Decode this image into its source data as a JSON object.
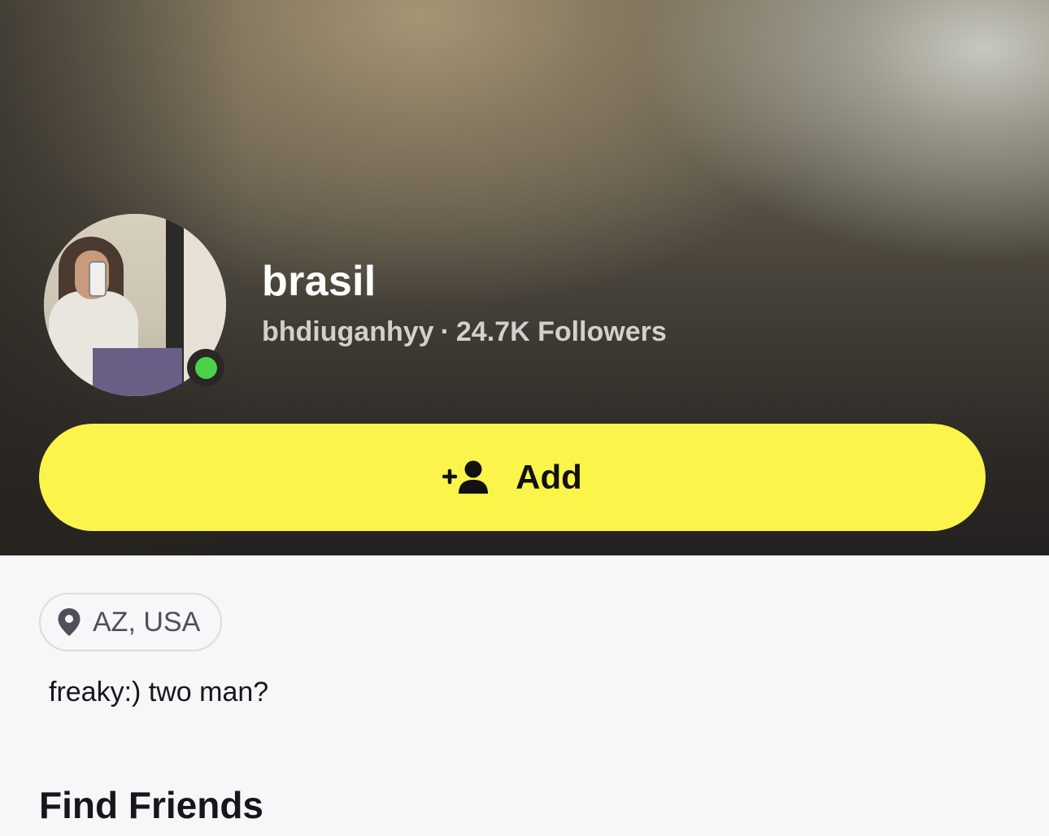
{
  "profile": {
    "display_name": "brasil",
    "username": "bhdiuganhyy",
    "separator": "·",
    "followers": "24.7K Followers",
    "online": true
  },
  "actions": {
    "add_label": "Add",
    "add_icon": "add-friend-icon"
  },
  "location": {
    "label": "AZ, USA",
    "icon": "location-pin-icon"
  },
  "bio": "freaky:) two man?",
  "sections": {
    "find_friends_title": "Find Friends"
  },
  "colors": {
    "add_button": "#fbf44b",
    "online": "#4cd14a",
    "background": "#f7f7f9"
  }
}
